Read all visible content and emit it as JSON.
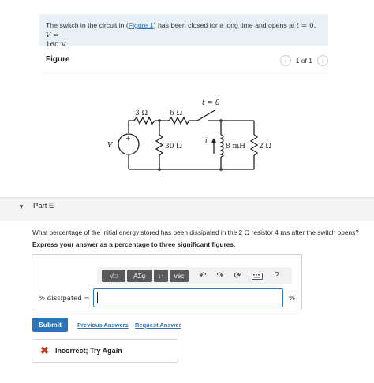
{
  "problem": {
    "text_1": "The switch in the circuit in (",
    "figure_link": "Figure 1",
    "text_2": ") has been closed for a long time and opens at ",
    "t_var": "t",
    "text_3": " = 0. ",
    "v_var": "V",
    "text_4": " =",
    "value": "160 V."
  },
  "figure": {
    "title": "Figure",
    "pager_count": "1 of 1",
    "prev_icon": "chevron-left-icon",
    "next_icon": "chevron-right-icon",
    "labels": {
      "r1": "3 Ω",
      "r2": "6 Ω",
      "switch": "t = 0",
      "source": "V",
      "r3": "30 Ω",
      "current": "i",
      "inductor": "8 mH",
      "r4": "2 Ω",
      "plus": "+",
      "minus": "−"
    }
  },
  "part": {
    "label": "Part E",
    "caret_icon": "caret-down-icon"
  },
  "question": {
    "text_1": "What percentage of the initial energy stored has been dissipated in the 2 ",
    "ohm": "Ω",
    "text_2": " resistor 4 ",
    "ms": "ms",
    "text_3": " after the switch opens?",
    "instruction": "Express your answer as a percentage to three significant figures."
  },
  "toolbar": {
    "templates_label": "√□",
    "greek_label": "ΑΣφ",
    "sort_label": "↓↑",
    "vec_label": "vec",
    "undo_icon": "undo-icon",
    "redo_icon": "redo-icon",
    "reset_icon": "reset-icon",
    "keyboard_icon": "keyboard-icon",
    "help_label": "?"
  },
  "answer": {
    "label": "% dissipated =",
    "value": "",
    "unit": "%"
  },
  "actions": {
    "submit": "Submit",
    "previous_answers": "Previous Answers",
    "request_answer": "Request Answer"
  },
  "feedback": {
    "icon": "x-icon",
    "message": "Incorrect; Try Again"
  },
  "colors": {
    "accent": "#2a76b8",
    "problem_bg": "#e9f1f6",
    "error": "#c0392b"
  }
}
